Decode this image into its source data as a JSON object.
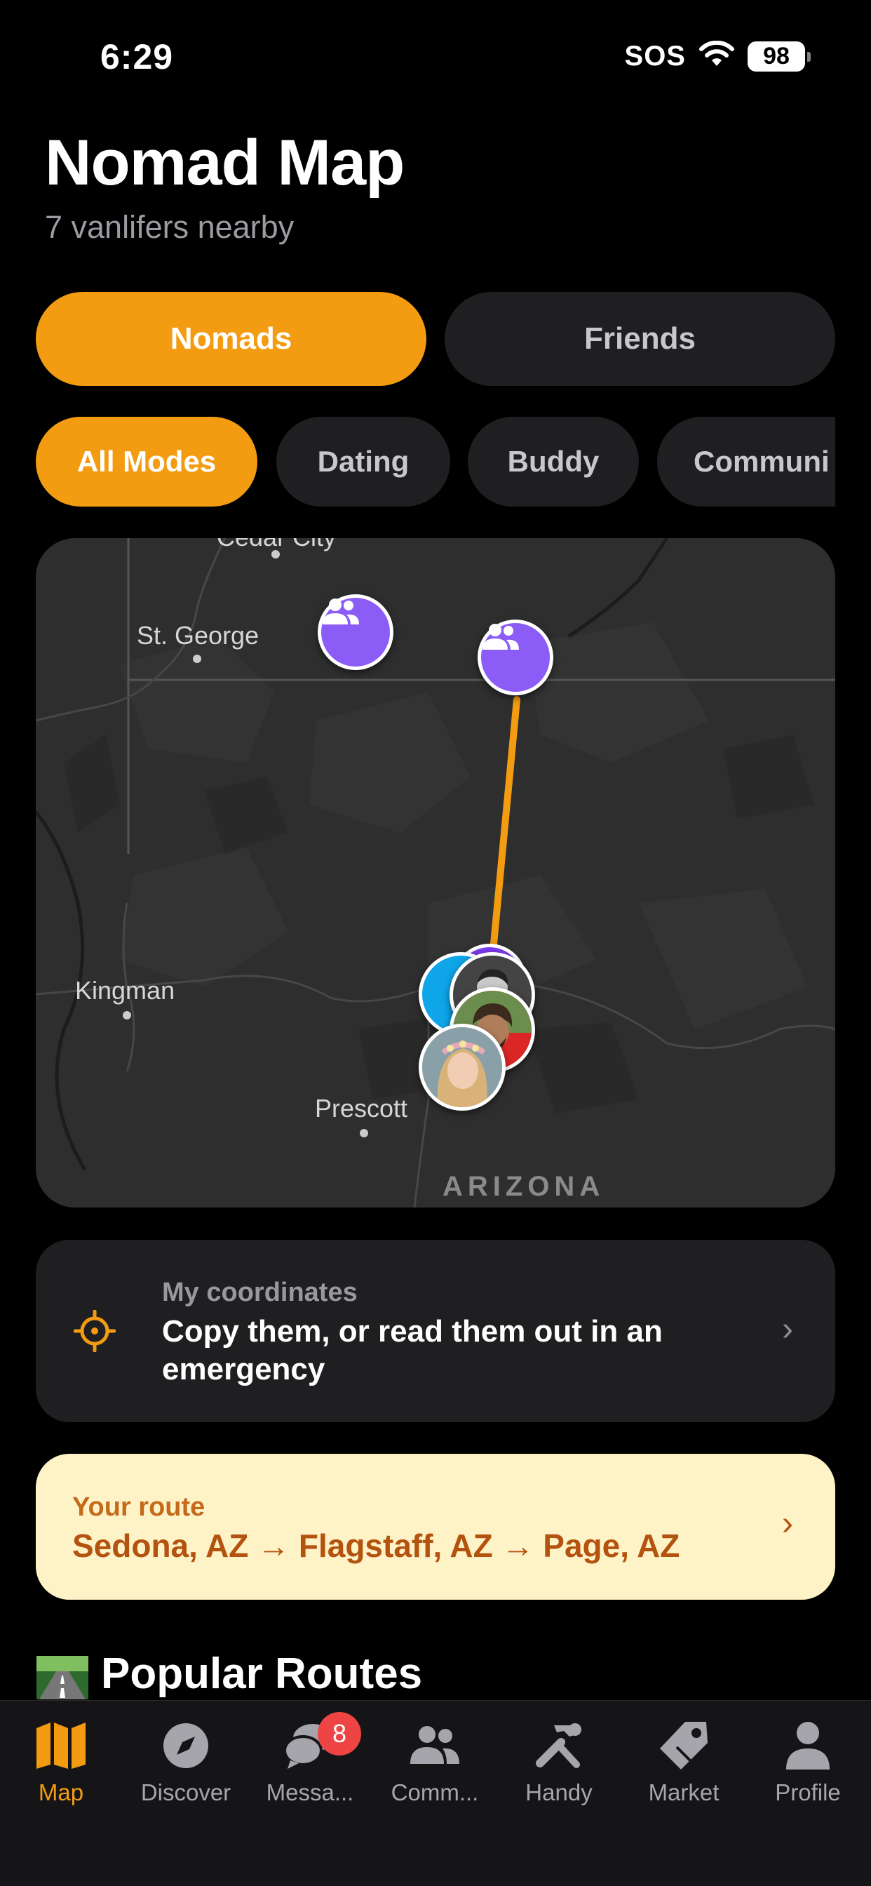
{
  "status": {
    "time": "6:29",
    "sos": "SOS",
    "battery": "98"
  },
  "header": {
    "title": "Nomad Map",
    "subtitle": "7 vanlifers nearby"
  },
  "segments": {
    "nomads": "Nomads",
    "friends": "Friends"
  },
  "chips": [
    {
      "label": "All Modes"
    },
    {
      "label": "Dating"
    },
    {
      "label": "Buddy"
    },
    {
      "label": "Communi"
    }
  ],
  "map": {
    "labels": {
      "cedar_city": "Cedar City",
      "st_george": "St. George",
      "kingman": "Kingman",
      "prescott": "Prescott",
      "arizona": "ARIZONA"
    },
    "route_color": "#f39c12",
    "pin_color": "#8b5cf6"
  },
  "coords_card": {
    "kicker": "My coordinates",
    "body": "Copy them, or read them out in an emergency",
    "chevron": "›"
  },
  "route_card": {
    "kicker": "Your route",
    "body": "Sedona, AZ → Flagstaff, AZ → Page, AZ",
    "chevron": "›"
  },
  "popular": {
    "title": "Popular Routes",
    "icon": "road-emoji-icon"
  },
  "tabs": [
    {
      "label": "Map",
      "icon": "map-icon",
      "active": true
    },
    {
      "label": "Discover",
      "icon": "compass-icon"
    },
    {
      "label": "Messa...",
      "icon": "chat-bubbles-icon",
      "badge": "8"
    },
    {
      "label": "Comm...",
      "icon": "people-icon"
    },
    {
      "label": "Handy",
      "icon": "tools-icon"
    },
    {
      "label": "Market",
      "icon": "tag-icon"
    },
    {
      "label": "Profile",
      "icon": "person-icon"
    }
  ],
  "colors": {
    "accent": "#f39c12",
    "card": "#1f1f22",
    "route_bg": "#fef3c7",
    "route_text": "#b4530f"
  }
}
